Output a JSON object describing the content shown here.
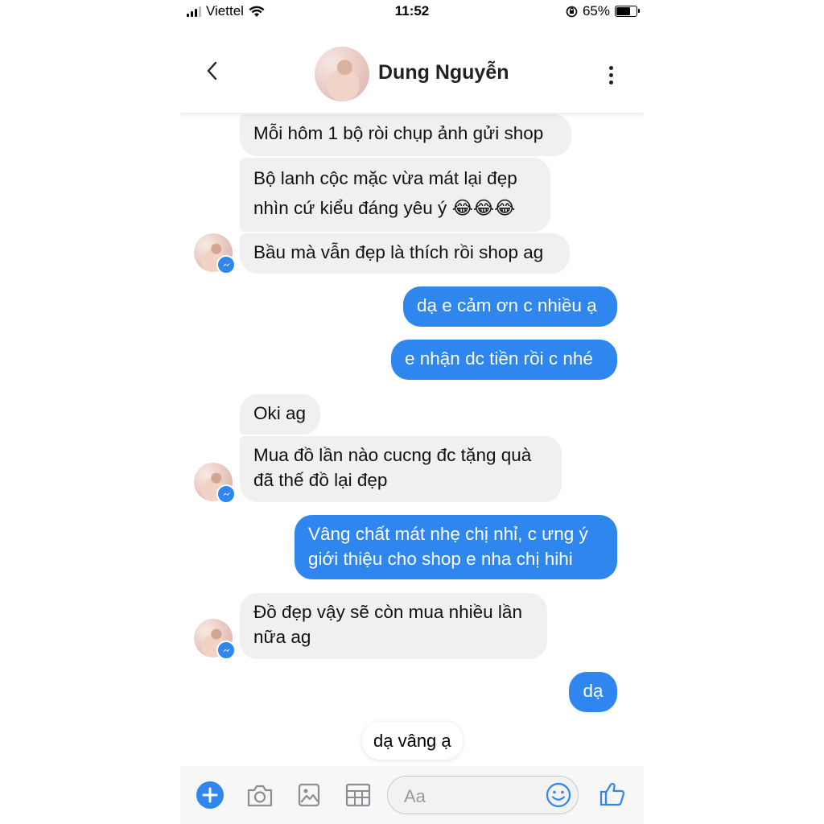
{
  "status_bar": {
    "carrier": "Viettel",
    "time": "11:52",
    "battery": "65%",
    "battery_level": 0.65
  },
  "header": {
    "contact_name": "Dung Nguyễn"
  },
  "messages": [
    {
      "side": "in",
      "text": "Mỗi hôm 1 bộ ròi chụp ảnh gửi shop"
    },
    {
      "side": "in",
      "text": "Bộ lanh cộc mặc vừa mát lại đẹp",
      "text2": "nhìn cứ kiểu đáng yêu ý 😂😂😂"
    },
    {
      "side": "in",
      "text": "Bầu mà vẫn đẹp là thích rồi shop ag"
    },
    {
      "side": "out",
      "text": "dạ e cảm ơn c nhiều ạ"
    },
    {
      "side": "out",
      "text": "e nhận dc tiền rồi c nhé"
    },
    {
      "side": "in",
      "text": "Oki ag"
    },
    {
      "side": "in",
      "text": "Mua đồ lần nào cucng đc tặng quà",
      "text2": "đã thế đồ lại đẹp"
    },
    {
      "side": "out",
      "text": "Vâng chất mát nhẹ chị nhỉ, c ưng ý",
      "text2": "giới thiệu cho shop e nha chị hihi"
    },
    {
      "side": "in",
      "text": "Đồ đẹp vậy sẽ còn mua nhiều lần",
      "text2": "nữa ag"
    },
    {
      "side": "out",
      "text": "dạ"
    }
  ],
  "quick_reply": "dạ vâng ạ",
  "composer": {
    "placeholder": "Aa"
  },
  "colors": {
    "accent": "#2e86ee",
    "incoming_bubble": "#f0f0f0"
  },
  "icons": [
    "back-icon",
    "more-icon",
    "plus-icon",
    "camera-icon",
    "image-icon",
    "grid-icon",
    "emoji-icon",
    "like-icon",
    "messenger-icon",
    "wifi-icon",
    "battery-icon",
    "signal-icon"
  ]
}
